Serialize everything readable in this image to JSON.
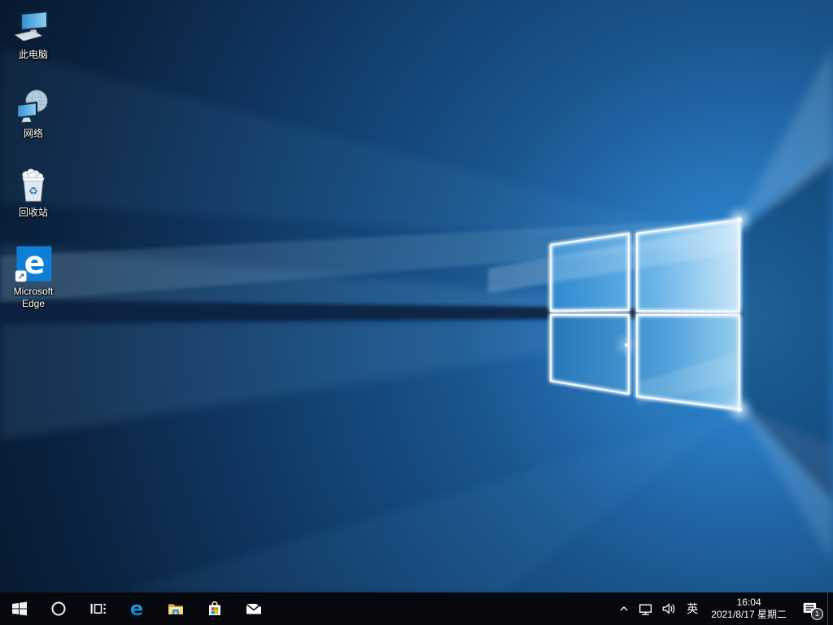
{
  "desktop": {
    "icons": [
      {
        "id": "this-pc",
        "label": "此电脑"
      },
      {
        "id": "network",
        "label": "网络"
      },
      {
        "id": "recycle-bin",
        "label": "回收站"
      },
      {
        "id": "microsoft-edge",
        "label": "Microsoft Edge"
      }
    ]
  },
  "taskbar": {
    "buttons": [
      "windows-start",
      "cortana-search",
      "task-view",
      "microsoft-edge",
      "file-explorer",
      "microsoft-store",
      "mail"
    ],
    "tray": {
      "input_indicator": "英",
      "clock": {
        "time": "16:04",
        "date": "2021/8/17 星期二"
      },
      "notification_badge": "1"
    }
  },
  "glyphs": {
    "edge_e": "e",
    "recycle": "♻",
    "shortcut_arrow": "↗"
  },
  "colors": {
    "taskbar_bg": "#06080d",
    "wallpaper_base": "#081a31",
    "wallpaper_glow": "#3b93d8",
    "logo_pane_light": "#cfeafa",
    "edge_blue": "#0d7fd8",
    "folder_yellow": "#f8d264",
    "store_red": "#f25022",
    "store_green": "#7fba00",
    "store_blue": "#00a4ef",
    "store_yellow": "#ffb900"
  }
}
